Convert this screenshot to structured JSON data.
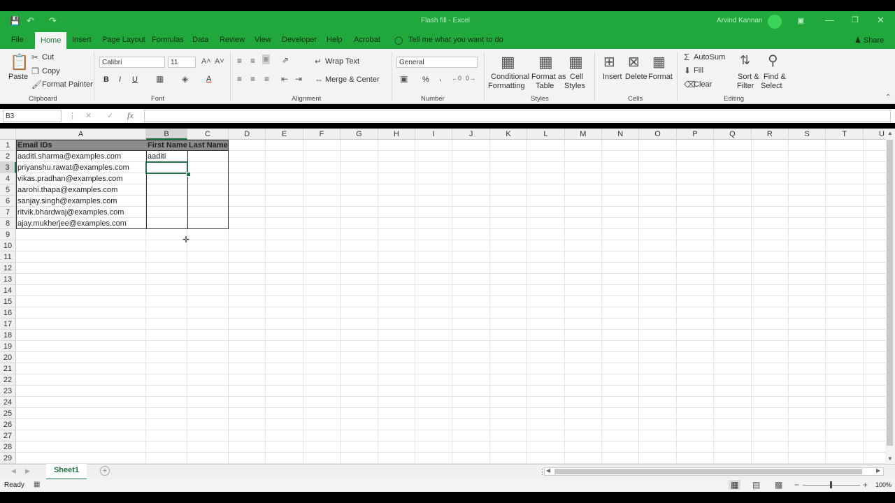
{
  "titlebar": {
    "doc_title": "Flash fill  -  Excel",
    "user": "Arvind Kannan"
  },
  "tabs": [
    "File",
    "Home",
    "Insert",
    "Page Layout",
    "Formulas",
    "Data",
    "Review",
    "View",
    "Developer",
    "Help",
    "Acrobat"
  ],
  "tell_me": "Tell me what you want to do",
  "share": "Share",
  "clipboard": {
    "paste": "Paste",
    "cut": "Cut",
    "copy": "Copy",
    "format_painter": "Format Painter",
    "group": "Clipboard"
  },
  "font": {
    "name": "Calibri",
    "size": "11",
    "bold": "B",
    "italic": "I",
    "underline": "U",
    "font_color": "A",
    "group": "Font"
  },
  "alignment": {
    "wrap": "Wrap Text",
    "merge": "Merge & Center",
    "group": "Alignment"
  },
  "number": {
    "format": "General",
    "percent": "%",
    "comma": ",",
    "group": "Number"
  },
  "styles": {
    "conditional": "Conditional",
    "conditional2": "Formatting",
    "format_as": "Format as",
    "format_as2": "Table",
    "cell": "Cell",
    "cell2": "Styles",
    "group": "Styles"
  },
  "cells": {
    "insert": "Insert",
    "delete": "Delete",
    "format": "Format",
    "group": "Cells"
  },
  "editing": {
    "autosum": "AutoSum",
    "fill": "Fill",
    "clear": "Clear",
    "sort": "Sort &",
    "sort2": "Filter",
    "find": "Find &",
    "find2": "Select",
    "group": "Editing"
  },
  "formula_bar": {
    "name_box": "B3",
    "fx": "fx",
    "cancel": "✕",
    "enter": "✓",
    "value": ""
  },
  "columns": [
    "A",
    "B",
    "C",
    "D",
    "E",
    "F",
    "G",
    "H",
    "I",
    "J",
    "K",
    "L",
    "M",
    "N",
    "O",
    "P",
    "Q",
    "R",
    "S",
    "T",
    "U"
  ],
  "rows": [
    "1",
    "2",
    "3",
    "4",
    "5",
    "6",
    "7",
    "8",
    "9",
    "10",
    "11",
    "12",
    "13",
    "14",
    "15",
    "16",
    "17",
    "18",
    "19",
    "20",
    "21",
    "22",
    "23",
    "24",
    "25",
    "26",
    "27",
    "28",
    "29"
  ],
  "sheet": {
    "headers": [
      "Email IDs",
      "First Name",
      "Last Name"
    ],
    "emails": [
      "aaditi.sharma@examples.com",
      "priyanshu.rawat@examples.com",
      "vikas.pradhan@examples.com",
      "aarohi.thapa@examples.com",
      "sanjay.singh@examples.com",
      "ritvik.bhardwaj@examples.com",
      "ajay.mukherjee@examples.com"
    ],
    "b2": "aaditi"
  },
  "sheet_tab": "Sheet1",
  "status": {
    "ready": "Ready",
    "zoom": "100%"
  }
}
